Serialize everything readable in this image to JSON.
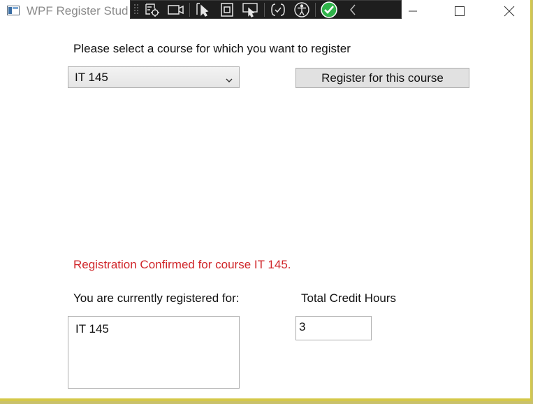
{
  "window": {
    "title": "WPF Register Student",
    "title_visible": "WPF Register Stud"
  },
  "debug_toolbar": {
    "buttons": [
      "select-element-icon",
      "record-video-icon",
      "pointer-select-icon",
      "element-bounds-icon",
      "display-layout-adorners-icon",
      "track-focus-icon",
      "accessibility-icon",
      "binding-check-icon",
      "collapse-toolbar-icon"
    ]
  },
  "controls": {
    "minimize": "—",
    "maximize": "☐",
    "close": "✕"
  },
  "form": {
    "select_prompt": "Please select a course for which you want to register",
    "course_combo_value": "IT 145",
    "register_button": "Register for this course",
    "confirmation_message": "Registration Confirmed for course IT 145.",
    "registered_label": "You are currently registered for:",
    "credit_hours_label": "Total Credit Hours",
    "registered_courses": [
      "IT 145"
    ],
    "credit_hours_value": "3"
  },
  "colors": {
    "confirmation": "#d0262a",
    "debug_toolbar_bg": "#1e1e1e",
    "window_border": "#d4c84a",
    "check_green": "#2fb34a"
  }
}
